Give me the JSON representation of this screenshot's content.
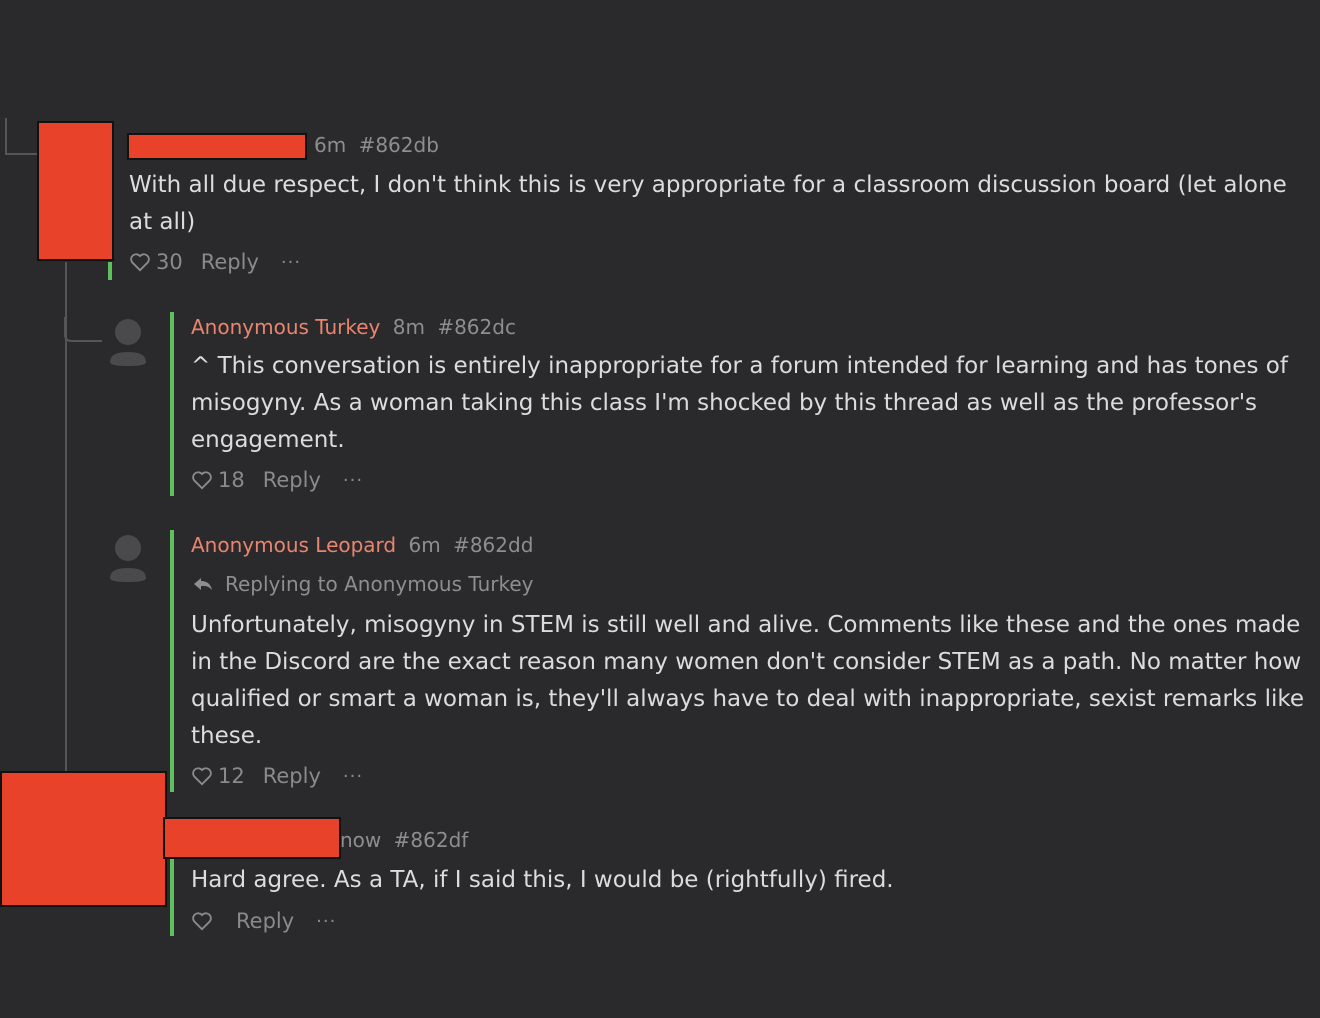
{
  "colors": {
    "background": "#2a2a2c",
    "accent": "#5cc15c",
    "username": "#e9856f",
    "redaction": "#e8432a"
  },
  "comments": [
    {
      "time": "6m",
      "id": "#862db",
      "text": "With all due respect, I don't think this is very appropriate for a classroom discussion board (let alone at all)",
      "likes": "30",
      "reply_label": "Reply",
      "more_label": "···"
    },
    {
      "author": "Anonymous Turkey",
      "time": "8m",
      "id": "#862dc",
      "text": "^ This conversation is entirely inappropriate for a forum intended for learning and has tones of misogyny. As a woman taking this class I'm shocked by this thread as well as the professor's engagement.",
      "likes": "18",
      "reply_label": "Reply",
      "more_label": "···"
    },
    {
      "author": "Anonymous Leopard",
      "time": "6m",
      "id": "#862dd",
      "replying_to": "Replying to Anonymous Turkey",
      "text": "Unfortunately, misogyny in STEM is still well and alive. Comments like these and the ones made in the Discord are the exact reason many women don't consider STEM as a path. No matter how qualified or smart a woman is, they'll always have to deal with inappropriate, sexist remarks like these.",
      "likes": "12",
      "reply_label": "Reply",
      "more_label": "···"
    },
    {
      "time": "now",
      "id": "#862df",
      "text": "Hard agree. As a TA, if I said this, I would be (rightfully) fired.",
      "likes": "",
      "reply_label": "Reply",
      "more_label": "···"
    }
  ]
}
